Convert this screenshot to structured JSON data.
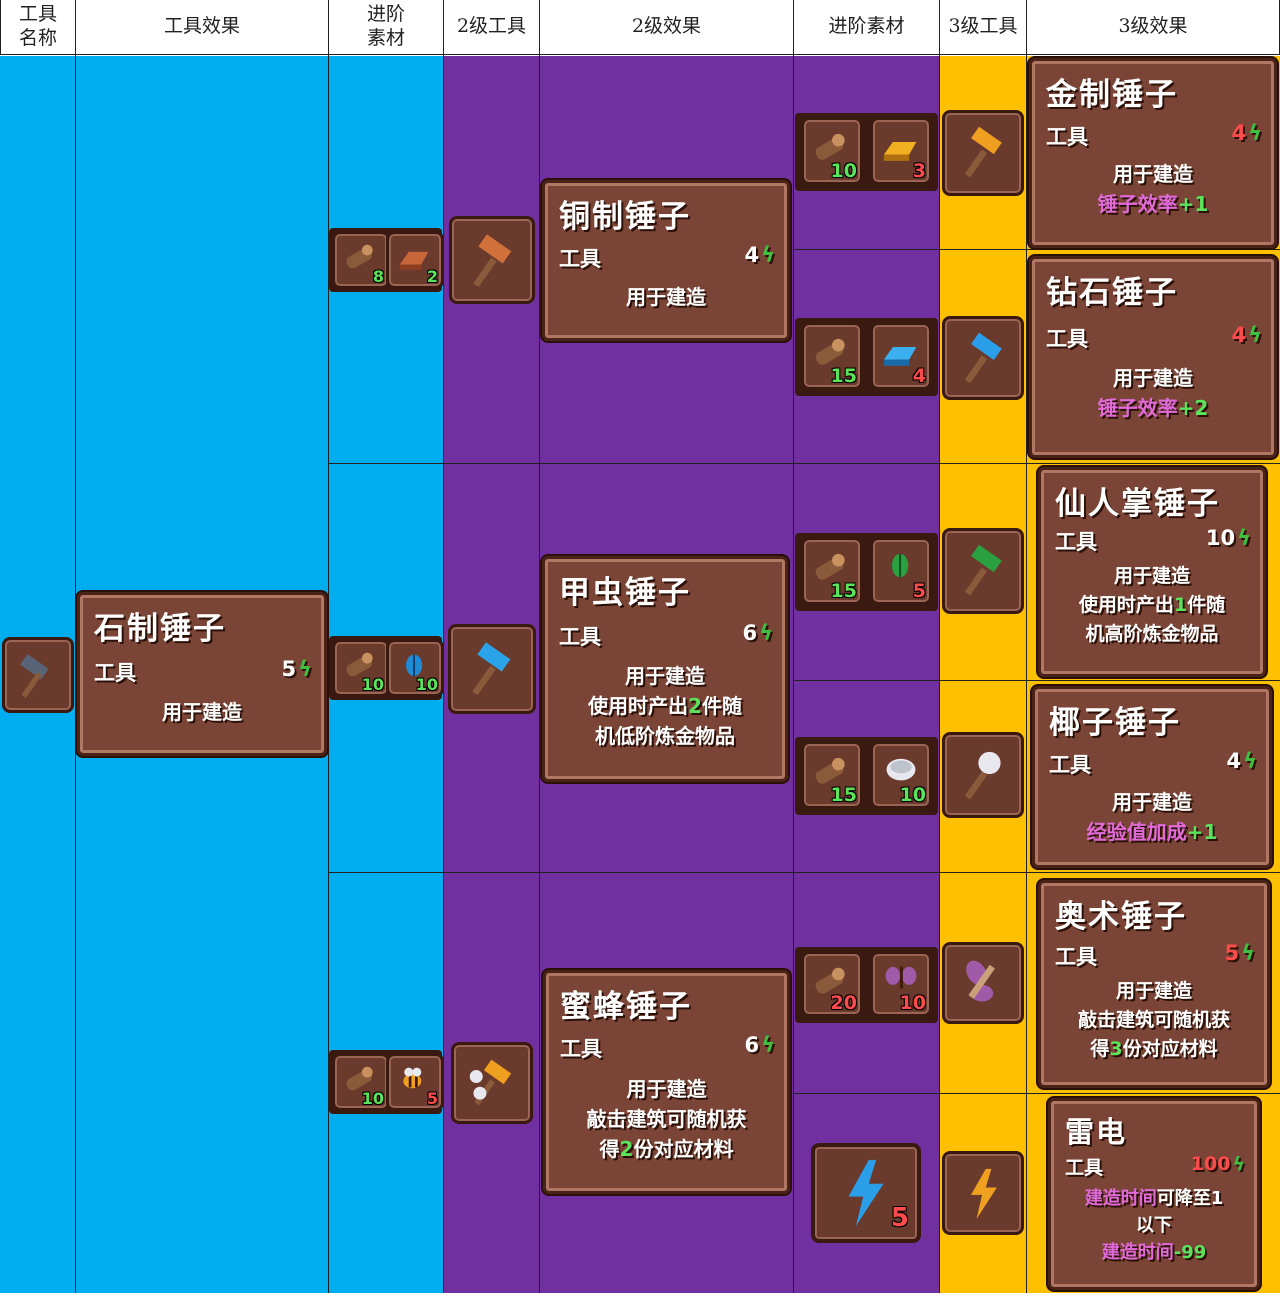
{
  "headers": {
    "tool_name": "工具\n名称",
    "tool_effect": "工具效果",
    "advance_mat_1": "进阶\n素材",
    "tier2_tool": "2级工具",
    "tier2_effect": "2级效果",
    "advance_mat_2": "进阶素材",
    "tier3_tool": "3级工具",
    "tier3_effect": "3级效果"
  },
  "colors": {
    "blue": "#00aeef",
    "purple": "#7030a0",
    "gold": "#ffc000",
    "panel": "#7a4536"
  },
  "base": {
    "icon": "stone-hammer-icon",
    "title": "石制锤子",
    "type": "工具",
    "cost": "5",
    "desc": "用于建造"
  },
  "tier2": [
    {
      "icon": "copper-hammer-icon",
      "title": "铜制锤子",
      "type": "工具",
      "cost": "4",
      "desc1": "用于建造",
      "mats": [
        {
          "icon": "wood-log-icon",
          "count": "8"
        },
        {
          "icon": "copper-bar-icon",
          "count": "2"
        }
      ]
    },
    {
      "icon": "beetle-hammer-icon",
      "title": "甲虫锤子",
      "type": "工具",
      "cost": "6",
      "desc1": "用于建造",
      "desc2a": "使用时产出",
      "desc2b": "2",
      "desc2c": "件随",
      "desc3": "机低阶炼金物品",
      "mats": [
        {
          "icon": "wood-log-icon",
          "count": "10"
        },
        {
          "icon": "blue-beetle-icon",
          "count": "10"
        }
      ]
    },
    {
      "icon": "bee-hammer-icon",
      "title": "蜜蜂锤子",
      "type": "工具",
      "cost": "6",
      "desc1": "用于建造",
      "desc2": "敲击建筑可随机获",
      "desc3a": "得",
      "desc3b": "2",
      "desc3c": "份对应材料",
      "mats": [
        {
          "icon": "wood-log-icon",
          "count": "10"
        },
        {
          "icon": "bee-icon",
          "count": "5"
        }
      ]
    }
  ],
  "tier3": [
    {
      "icon": "gold-hammer-icon",
      "title": "金制锤子",
      "type": "工具",
      "cost": "4",
      "desc1": "用于建造",
      "bonus_label": "锤子效率",
      "bonus_value": "+1",
      "mats": [
        {
          "icon": "wood-log-icon",
          "count": "10"
        },
        {
          "icon": "gold-bar-icon",
          "count": "3"
        }
      ]
    },
    {
      "icon": "diamond-hammer-icon",
      "title": "钻石锤子",
      "type": "工具",
      "cost": "4",
      "desc1": "用于建造",
      "bonus_label": "锤子效率",
      "bonus_value": "+2",
      "mats": [
        {
          "icon": "wood-log-icon",
          "count": "15"
        },
        {
          "icon": "diamond-bar-icon",
          "count": "4"
        }
      ]
    },
    {
      "icon": "cactus-hammer-icon",
      "title": "仙人掌锤子",
      "type": "工具",
      "cost": "10",
      "desc1": "用于建造",
      "desc2a": "使用时产出",
      "desc2b": "1",
      "desc2c": "件随",
      "desc3": "机高阶炼金物品",
      "mats": [
        {
          "icon": "wood-log-icon",
          "count": "15"
        },
        {
          "icon": "green-beetle-icon",
          "count": "5"
        }
      ]
    },
    {
      "icon": "coconut-hammer-icon",
      "title": "椰子锤子",
      "type": "工具",
      "cost": "4",
      "desc1": "用于建造",
      "bonus_label": "经验值加成",
      "bonus_value": "+1",
      "mats": [
        {
          "icon": "wood-log-icon",
          "count": "15"
        },
        {
          "icon": "coconut-icon",
          "count": "10"
        }
      ]
    },
    {
      "icon": "arcane-hammer-icon",
      "title": "奥术锤子",
      "type": "工具",
      "cost": "5",
      "desc1": "用于建造",
      "desc2": "敲击建筑可随机获",
      "desc3a": "得",
      "desc3b": "3",
      "desc3c": "份对应材料",
      "mats": [
        {
          "icon": "wood-log-icon",
          "count": "20"
        },
        {
          "icon": "butterfly-icon",
          "count": "10"
        }
      ]
    },
    {
      "icon": "lightning-icon",
      "title": "雷电",
      "type": "工具",
      "cost": "100",
      "desc1a": "建造时间",
      "desc1b": "可降至",
      "desc1c": "1",
      "desc2": "以下",
      "desc3a": "建造时间",
      "desc3b": "-99",
      "mats": [
        {
          "icon": "lightning-bolt-icon",
          "count": "5"
        }
      ]
    }
  ]
}
